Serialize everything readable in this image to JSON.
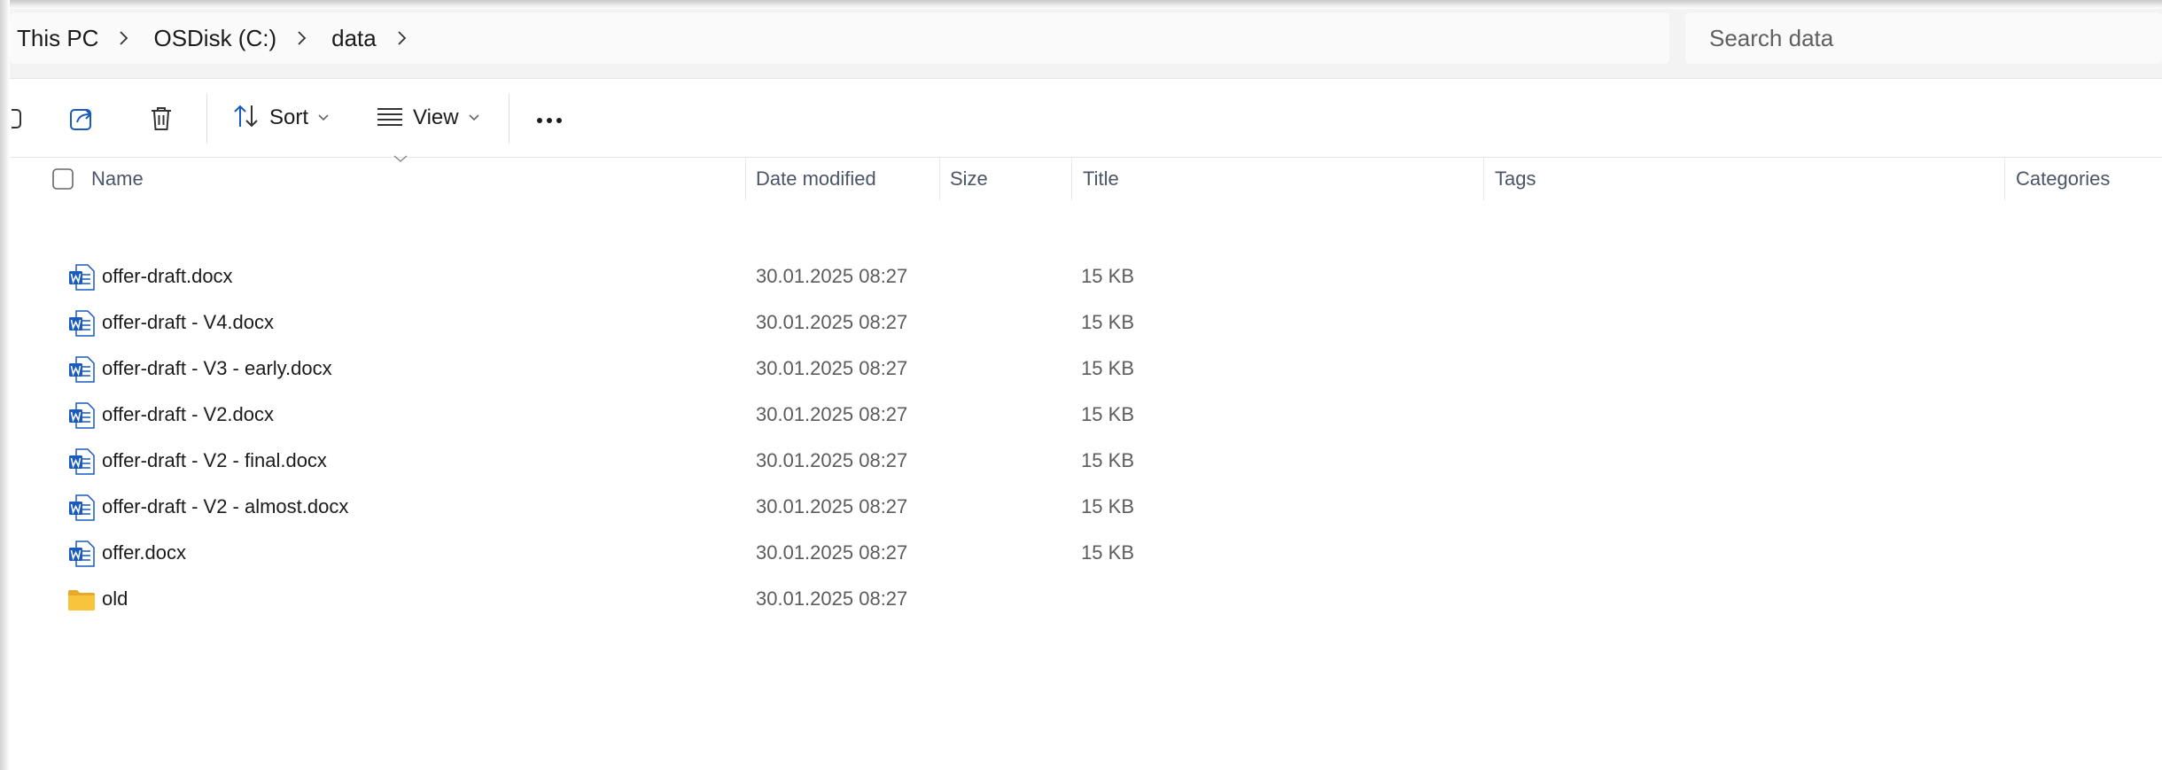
{
  "address_bar": {
    "breadcrumbs": [
      "This PC",
      "OSDisk (C:)",
      "data"
    ],
    "separator_icon": "chevron-right-icon"
  },
  "search": {
    "placeholder": "Search data"
  },
  "command_bar": {
    "buttons": [
      {
        "name": "copy",
        "icon": "copy-icon"
      },
      {
        "name": "share",
        "icon": "share-icon"
      },
      {
        "name": "delete",
        "icon": "trash-icon"
      }
    ],
    "sort_label": "Sort",
    "view_label": "View",
    "more_icon": "more-icon"
  },
  "columns": {
    "name": "Name",
    "date_modified": "Date modified",
    "size": "Size",
    "title": "Title",
    "tags": "Tags",
    "categories": "Categories"
  },
  "files": [
    {
      "name": "offer-draft.docx",
      "date": "30.01.2025 08:27",
      "size": "15 KB",
      "icon": "word-doc-icon"
    },
    {
      "name": "offer-draft - V4.docx",
      "date": "30.01.2025 08:27",
      "size": "15 KB",
      "icon": "word-doc-icon"
    },
    {
      "name": "offer-draft - V3 - early.docx",
      "date": "30.01.2025 08:27",
      "size": "15 KB",
      "icon": "word-doc-icon"
    },
    {
      "name": "offer-draft - V2.docx",
      "date": "30.01.2025 08:27",
      "size": "15 KB",
      "icon": "word-doc-icon"
    },
    {
      "name": "offer-draft - V2 - final.docx",
      "date": "30.01.2025 08:27",
      "size": "15 KB",
      "icon": "word-doc-icon"
    },
    {
      "name": "offer-draft - V2 - almost.docx",
      "date": "30.01.2025 08:27",
      "size": "15 KB",
      "icon": "word-doc-icon"
    },
    {
      "name": "offer.docx",
      "date": "30.01.2025 08:27",
      "size": "15 KB",
      "icon": "word-doc-icon"
    },
    {
      "name": "old",
      "date": "30.01.2025 08:27",
      "size": "",
      "icon": "folder-icon"
    }
  ],
  "colors": {
    "word_blue": "#185abd",
    "folder_yellow": "#f8c43c",
    "header_text": "#4a5568"
  }
}
